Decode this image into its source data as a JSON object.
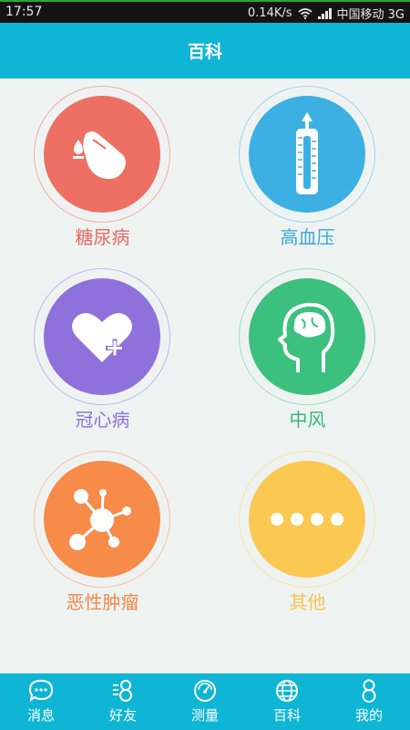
{
  "status_bar": {
    "time": "17:57",
    "speed": "0.14K/s",
    "carrier": "中国移动 3G"
  },
  "header": {
    "title": "百科"
  },
  "categories": [
    {
      "label": "糖尿病",
      "icon": "blood-drop-finger-icon",
      "color": "#ee6f63",
      "label_color": "#e56a5f",
      "ring_color": "#f2aaa3"
    },
    {
      "label": "高血压",
      "icon": "thermometer-icon",
      "color": "#3db0e3",
      "label_color": "#3aa6d9",
      "ring_color": "#9dd2ec"
    },
    {
      "label": "冠心病",
      "icon": "heart-plus-icon",
      "color": "#8f71dc",
      "label_color": "#8e72d6",
      "ring_color": "#c3b2ee"
    },
    {
      "label": "中风",
      "icon": "brain-head-icon",
      "color": "#3cc07d",
      "label_color": "#39b775",
      "ring_color": "#9ddfbd"
    },
    {
      "label": "恶性肿瘤",
      "icon": "molecule-icon",
      "color": "#f68b4a",
      "label_color": "#f08848",
      "ring_color": "#f8c19e"
    },
    {
      "label": "其他",
      "icon": "more-dots-icon",
      "color": "#fbc852",
      "label_color": "#f5c64e",
      "ring_color": "#fbe1a5"
    }
  ],
  "tabs": [
    {
      "label": "消息",
      "icon": "chat-bubble-icon"
    },
    {
      "label": "好友",
      "icon": "friends-icon"
    },
    {
      "label": "测量",
      "icon": "gauge-icon"
    },
    {
      "label": "百科",
      "icon": "globe-icon",
      "active": true
    },
    {
      "label": "我的",
      "icon": "person-icon"
    }
  ],
  "colors": {
    "accent": "#0fb5d4",
    "background": "#eef3f2"
  }
}
